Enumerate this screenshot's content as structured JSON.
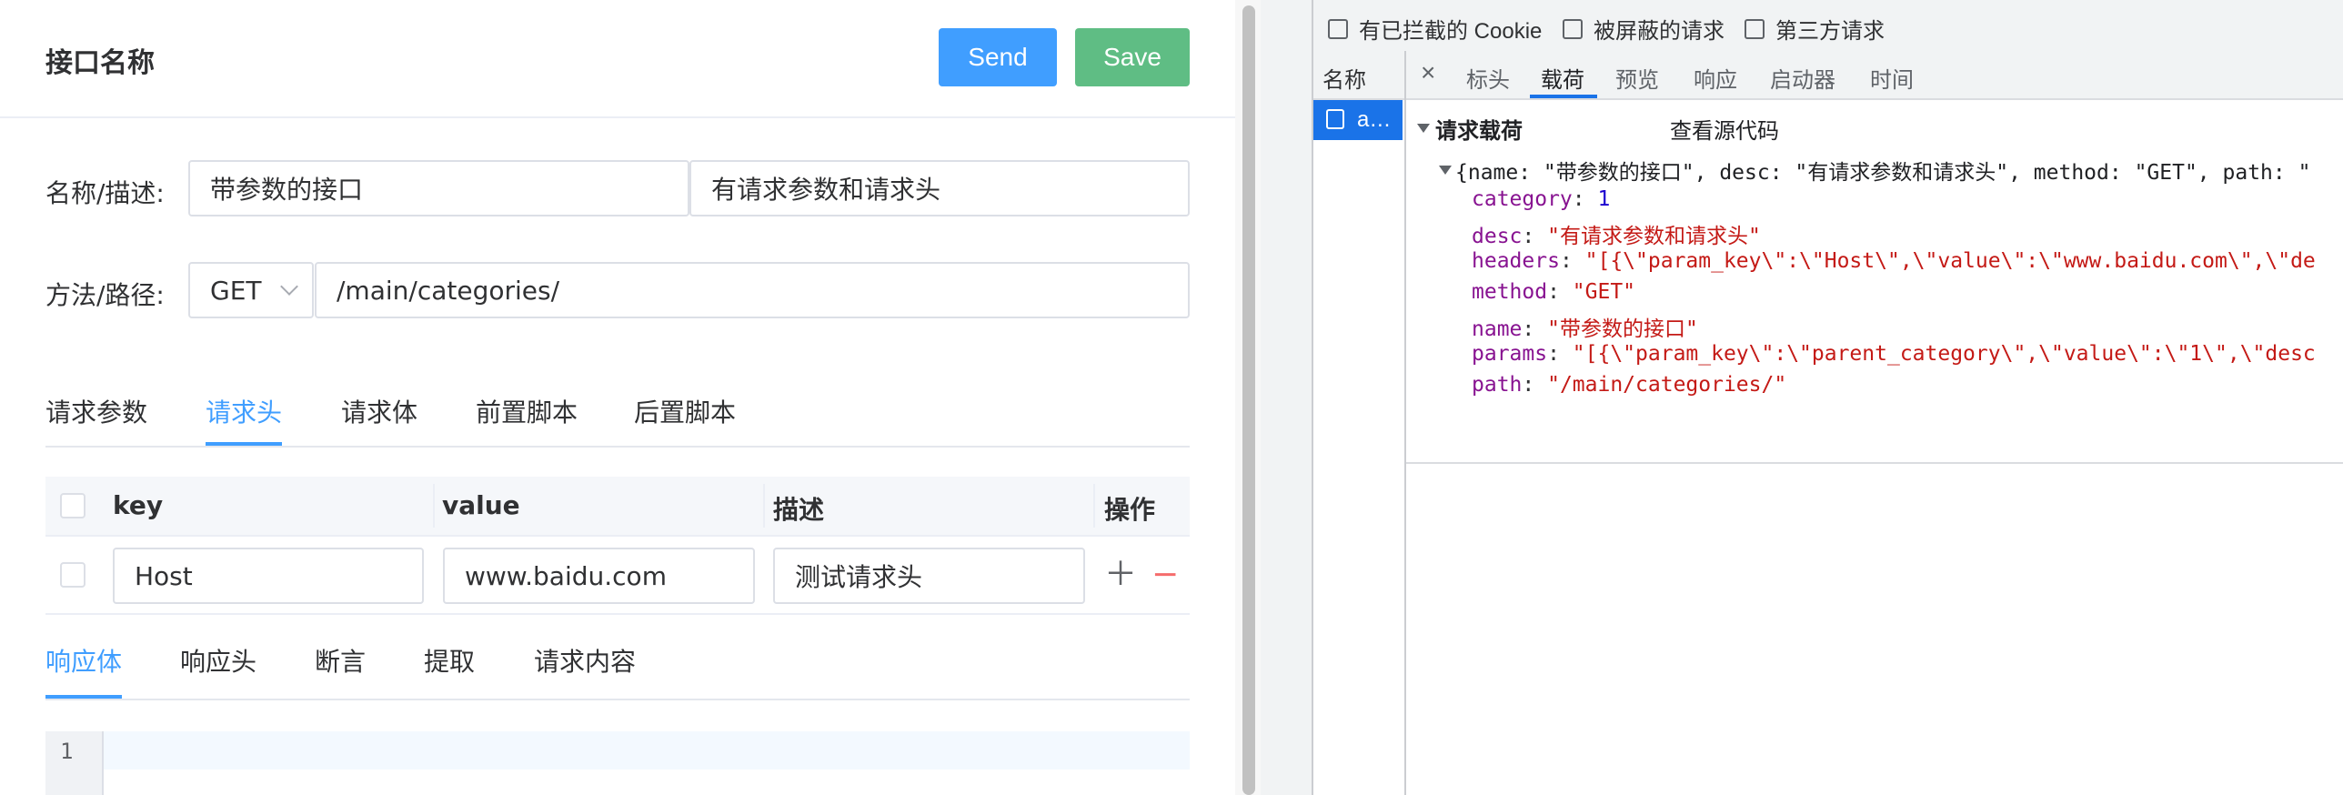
{
  "header": {
    "title": "接口名称",
    "send_label": "Send",
    "save_label": "Save"
  },
  "form": {
    "name_label": "名称/描述:",
    "name_value": "带参数的接口",
    "desc_value": "有请求参数和请求头",
    "method_label": "方法/路径:",
    "method_value": "GET",
    "path_value": "/main/categories/"
  },
  "request_tabs": [
    "请求参数",
    "请求头",
    "请求体",
    "前置脚本",
    "后置脚本"
  ],
  "request_tab_active": "请求头",
  "table": {
    "columns": [
      "key",
      "value",
      "描述",
      "操作"
    ],
    "rows": [
      {
        "key": "Host",
        "value": "www.baidu.com",
        "desc": "测试请求头"
      }
    ]
  },
  "response_tabs": [
    "响应体",
    "响应头",
    "断言",
    "提取",
    "请求内容"
  ],
  "response_tab_active": "响应体",
  "editor": {
    "line_number": "1"
  },
  "devtools": {
    "filters": [
      "有已拦截的 Cookie",
      "被屏蔽的请求",
      "第三方请求"
    ],
    "list_header": "名称",
    "selected_request": "a…",
    "close_label": "×",
    "tabs": [
      "标头",
      "载荷",
      "预览",
      "响应",
      "启动器",
      "时间"
    ],
    "active_tab": "载荷",
    "payload_title": "请求载荷",
    "view_source": "查看源代码",
    "summary": "{name: \"带参数的接口\", desc: \"有请求参数和请求头\", method: \"GET\", path: \"",
    "fields": [
      {
        "key": "category",
        "value": "1",
        "kind": "num"
      },
      {
        "key": "desc",
        "value": "\"有请求参数和请求头\"",
        "kind": "str"
      },
      {
        "key": "headers",
        "value": "\"[{\\\"param_key\\\":\\\"Host\\\",\\\"value\\\":\\\"www.baidu.com\\\",\\\"de",
        "kind": "str"
      },
      {
        "key": "method",
        "value": "\"GET\"",
        "kind": "str"
      },
      {
        "key": "name",
        "value": "\"带参数的接口\"",
        "kind": "str"
      },
      {
        "key": "params",
        "value": "\"[{\\\"param_key\\\":\\\"parent_category\\\",\\\"value\\\":\\\"1\\\",\\\"desc",
        "kind": "str"
      },
      {
        "key": "path",
        "value": "\"/main/categories/\"",
        "kind": "str"
      }
    ]
  },
  "colors": {
    "primary": "#409eff",
    "success": "#5fbd84",
    "danger": "#f56c6c",
    "devtools_accent": "#1a73e8"
  }
}
